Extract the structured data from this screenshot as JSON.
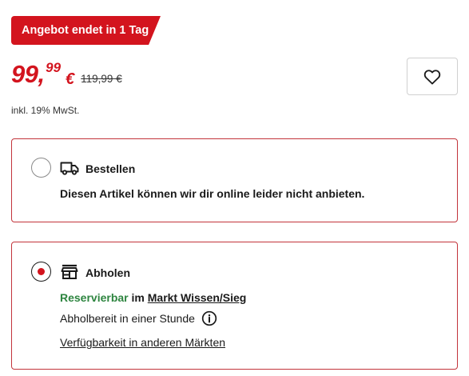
{
  "promo": {
    "label": "Angebot endet in 1 Tag"
  },
  "price": {
    "integer": "99",
    "separator": ",",
    "decimals": "99",
    "currency": "€",
    "old_price": "119,99 €",
    "vat_note": "inkl. 19% MwSt."
  },
  "colors": {
    "accent_red": "#d3141e",
    "available_green": "#2e8540",
    "card_border": "#c2343b"
  },
  "wishlist": {
    "icon": "heart-icon"
  },
  "delivery_options": {
    "order": {
      "icon": "truck-icon",
      "title": "Bestellen",
      "selected": false,
      "message": "Diesen Artikel können wir dir online leider nicht anbieten."
    },
    "pickup": {
      "icon": "store-icon",
      "title": "Abholen",
      "selected": true,
      "status": "Reservierbar",
      "status_connector": " im ",
      "store": "Markt Wissen/Sieg",
      "ready_time": "Abholbereit in einer Stunde",
      "availability_link": "Verfügbarkeit in anderen Märkten"
    }
  }
}
